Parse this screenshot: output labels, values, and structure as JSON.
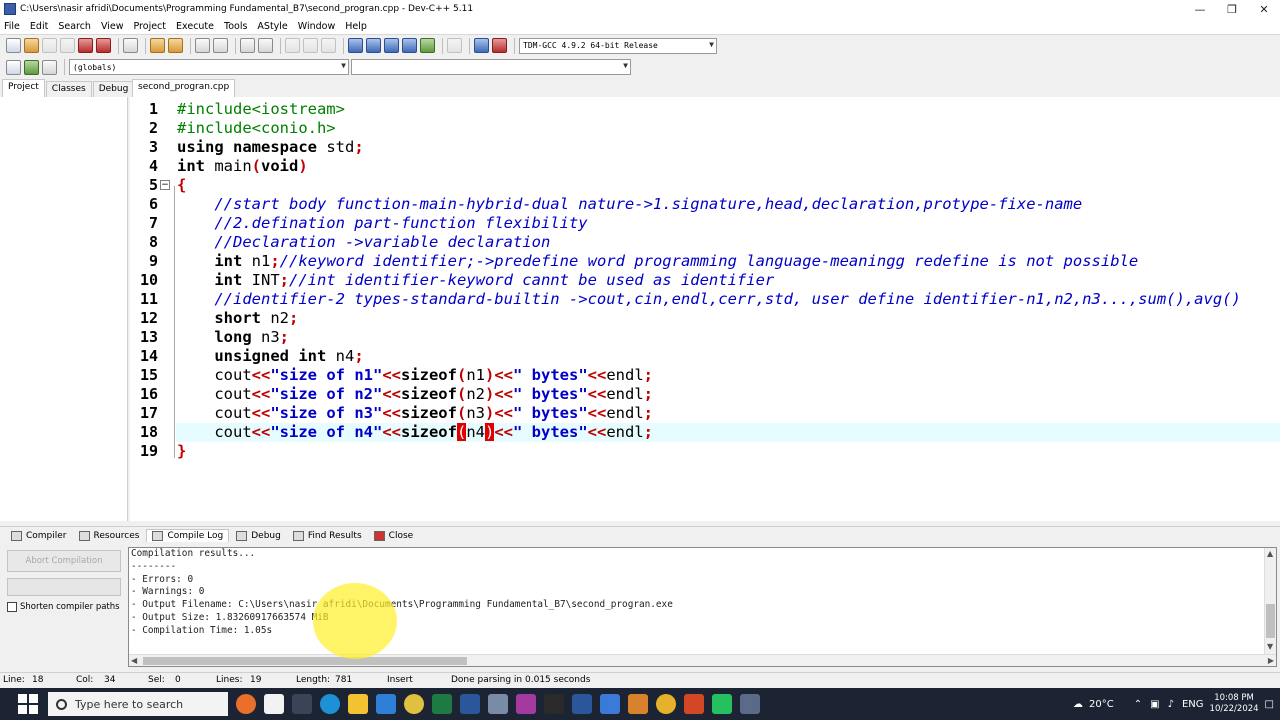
{
  "window": {
    "title": "C:\\Users\\nasir afridi\\Documents\\Programming Fundamental_B7\\second_progran.cpp - Dev-C++ 5.11"
  },
  "menu": [
    "File",
    "Edit",
    "Search",
    "View",
    "Project",
    "Execute",
    "Tools",
    "AStyle",
    "Window",
    "Help"
  ],
  "toolbar": {
    "compiler_select": "TDM-GCC 4.9.2 64-bit Release",
    "scope_select": "(globals)",
    "member_select": ""
  },
  "left_tabs": [
    "Project",
    "Classes",
    "Debug"
  ],
  "file_tab": "second_progran.cpp",
  "editor": {
    "line_numbers": [
      "1",
      "2",
      "3",
      "4",
      "5",
      "6",
      "7",
      "8",
      "9",
      "10",
      "11",
      "12",
      "13",
      "14",
      "15",
      "16",
      "17",
      "18",
      "19"
    ],
    "current_line": 18,
    "lines": [
      [
        [
          "pp",
          "#include<iostream>"
        ]
      ],
      [
        [
          "pp",
          "#include<conio.h>"
        ]
      ],
      [
        [
          "kw",
          "using namespace "
        ],
        [
          "id",
          "std"
        ],
        [
          "op",
          ";"
        ]
      ],
      [
        [
          "kw",
          "int "
        ],
        [
          "id",
          "main"
        ],
        [
          "br",
          "("
        ],
        [
          "kw",
          "void"
        ],
        [
          "br",
          ")"
        ]
      ],
      [
        [
          "br",
          "{"
        ]
      ],
      [
        [
          "id",
          "    "
        ],
        [
          "cm",
          "//start body function-main-hybrid-dual nature->1.signature,head,declaration,protype-fixe-name"
        ]
      ],
      [
        [
          "id",
          "    "
        ],
        [
          "cm",
          "//2.defination part-function flexibility"
        ]
      ],
      [
        [
          "id",
          "    "
        ],
        [
          "cm",
          "//Declaration ->variable declaration"
        ]
      ],
      [
        [
          "id",
          "    "
        ],
        [
          "kw",
          "int "
        ],
        [
          "id",
          "n1"
        ],
        [
          "op",
          ";"
        ],
        [
          "cm",
          "//keyword identifier;->predefine word programming language-meaningg redefine is not possible"
        ]
      ],
      [
        [
          "id",
          "    "
        ],
        [
          "kw",
          "int "
        ],
        [
          "id",
          "INT"
        ],
        [
          "op",
          ";"
        ],
        [
          "cm",
          "//int identifier-keyword cannt be used as identifier"
        ]
      ],
      [
        [
          "id",
          "    "
        ],
        [
          "cm",
          "//identifier-2 types-standard-builtin ->cout,cin,endl,cerr,std, user define identifier-n1,n2,n3...,sum(),avg()"
        ]
      ],
      [
        [
          "id",
          "    "
        ],
        [
          "kw",
          "short "
        ],
        [
          "id",
          "n2"
        ],
        [
          "op",
          ";"
        ]
      ],
      [
        [
          "id",
          "    "
        ],
        [
          "kw",
          "long "
        ],
        [
          "id",
          "n3"
        ],
        [
          "op",
          ";"
        ]
      ],
      [
        [
          "id",
          "    "
        ],
        [
          "kw",
          "unsigned int "
        ],
        [
          "id",
          "n4"
        ],
        [
          "op",
          ";"
        ]
      ],
      [
        [
          "id",
          "    cout"
        ],
        [
          "op",
          "<<"
        ],
        [
          "st",
          "\"size of n1\""
        ],
        [
          "op",
          "<<"
        ],
        [
          "kw",
          "sizeof"
        ],
        [
          "br",
          "("
        ],
        [
          "id",
          "n1"
        ],
        [
          "br",
          ")"
        ],
        [
          "op",
          "<<"
        ],
        [
          "st",
          "\" bytes\""
        ],
        [
          "op",
          "<<"
        ],
        [
          "id",
          "endl"
        ],
        [
          "op",
          ";"
        ]
      ],
      [
        [
          "id",
          "    cout"
        ],
        [
          "op",
          "<<"
        ],
        [
          "st",
          "\"size of n2\""
        ],
        [
          "op",
          "<<"
        ],
        [
          "kw",
          "sizeof"
        ],
        [
          "br",
          "("
        ],
        [
          "id",
          "n2"
        ],
        [
          "br",
          ")"
        ],
        [
          "op",
          "<<"
        ],
        [
          "st",
          "\" bytes\""
        ],
        [
          "op",
          "<<"
        ],
        [
          "id",
          "endl"
        ],
        [
          "op",
          ";"
        ]
      ],
      [
        [
          "id",
          "    cout"
        ],
        [
          "op",
          "<<"
        ],
        [
          "st",
          "\"size of n3\""
        ],
        [
          "op",
          "<<"
        ],
        [
          "kw",
          "sizeof"
        ],
        [
          "br",
          "("
        ],
        [
          "id",
          "n3"
        ],
        [
          "br",
          ")"
        ],
        [
          "op",
          "<<"
        ],
        [
          "st",
          "\" bytes\""
        ],
        [
          "op",
          "<<"
        ],
        [
          "id",
          "endl"
        ],
        [
          "op",
          ";"
        ]
      ],
      [
        [
          "id",
          "    cout"
        ],
        [
          "op",
          "<<"
        ],
        [
          "st",
          "\"size of n4\""
        ],
        [
          "op",
          "<<"
        ],
        [
          "kw",
          "sizeof"
        ],
        [
          "hl",
          "("
        ],
        [
          "id",
          "n4"
        ],
        [
          "hl",
          ")"
        ],
        [
          "op",
          "<<"
        ],
        [
          "st",
          "\" bytes\""
        ],
        [
          "op",
          "<<"
        ],
        [
          "id",
          "endl"
        ],
        [
          "op",
          ";"
        ]
      ],
      [
        [
          "br",
          "}"
        ]
      ]
    ]
  },
  "bottom_tabs": [
    "Compiler",
    "Resources",
    "Compile Log",
    "Debug",
    "Find Results",
    "Close"
  ],
  "bottom_left": {
    "abort_label": "Abort Compilation",
    "shorten_label": "Shorten compiler paths"
  },
  "compile_log": [
    "Compilation results...",
    "--------",
    "- Errors: 0",
    "- Warnings: 0",
    "- Output Filename: C:\\Users\\nasir afridi\\Documents\\Programming Fundamental_B7\\second_progran.exe",
    "- Output Size: 1.83260917663574 MiB",
    "- Compilation Time: 1.05s"
  ],
  "status": {
    "line": "Line:",
    "line_val": "18",
    "col": "Col:",
    "col_val": "34",
    "sel": "Sel:",
    "sel_val": "0",
    "lines": "Lines:",
    "lines_val": "19",
    "length": "Length:",
    "length_val": "781",
    "mode": "Insert",
    "message": "Done parsing in 0.015 seconds"
  },
  "taskbar": {
    "search_placeholder": "Type here to search",
    "temp": "20°C",
    "lang": "ENG",
    "time": "10:08 PM",
    "date": "10/22/2024"
  }
}
